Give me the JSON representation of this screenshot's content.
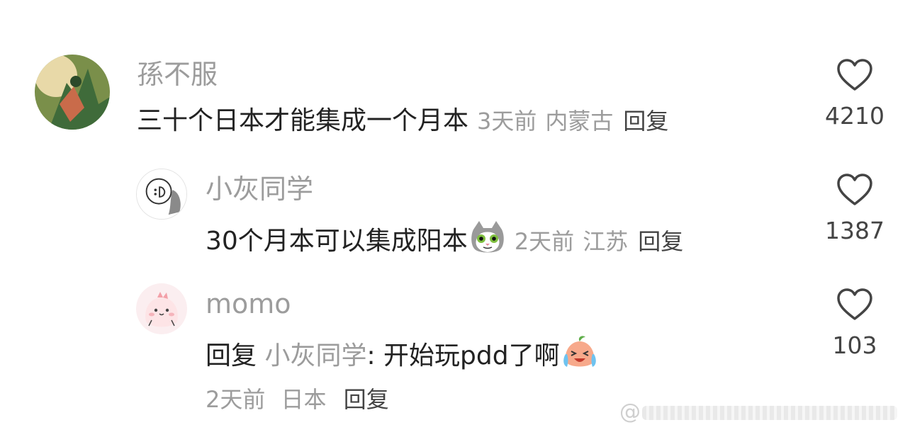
{
  "comments": [
    {
      "username": "孫不服",
      "text": "三十个日本才能集成一个月本",
      "time": "3天前",
      "location": "内蒙古",
      "reply_label": "回复",
      "likes": "4210"
    },
    {
      "username": "小灰同学",
      "text": "30个月本可以集成阳本",
      "time": "2天前",
      "location": "江苏",
      "reply_label": "回复",
      "likes": "1387",
      "emoji": "cat-face-emoji"
    },
    {
      "username": "momo",
      "reply_prefix": "回复",
      "reply_to": "小灰同学",
      "text": ": 开始玩pdd了啊",
      "time": "2天前",
      "location": "日本",
      "reply_label": "回复",
      "likes": "103",
      "emoji": "crying-laughing-peach-emoji"
    }
  ],
  "watermark": "@",
  "colors": {
    "secondary_text": "#9c9c9c",
    "primary_text": "#222222"
  }
}
